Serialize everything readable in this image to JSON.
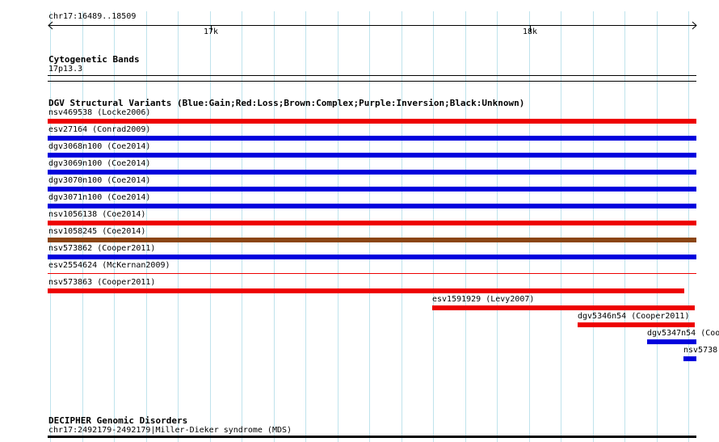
{
  "ruler": {
    "location": "chr17:16489..18509",
    "ticks": [
      "17k",
      "18k"
    ]
  },
  "cytoband": {
    "title": "Cytogenetic Bands",
    "band": "17p13.3"
  },
  "dgv": {
    "title": "DGV Structural Variants (Blue:Gain;Red:Loss;Brown:Complex;Purple:Inversion;Black:Unknown)",
    "colors": {
      "gain": "#0000dd",
      "loss": "#ee0000",
      "complex": "#8b4513",
      "inversion": "#800080",
      "unknown": "#000000"
    },
    "features": [
      {
        "label": "nsv469538 (Locke2006)",
        "type": "loss"
      },
      {
        "label": "esv27164 (Conrad2009)",
        "type": "gain"
      },
      {
        "label": "dgv3068n100 (Coe2014)",
        "type": "gain"
      },
      {
        "label": "dgv3069n100 (Coe2014)",
        "type": "gain"
      },
      {
        "label": "dgv3070n100 (Coe2014)",
        "type": "gain"
      },
      {
        "label": "dgv3071n100 (Coe2014)",
        "type": "gain"
      },
      {
        "label": "nsv1056138 (Coe2014)",
        "type": "loss"
      },
      {
        "label": "nsv1058245 (Coe2014)",
        "type": "complex"
      },
      {
        "label": "nsv573862 (Cooper2011)",
        "type": "gain"
      },
      {
        "label": "esv2554624 (McKernan2009)",
        "type": "loss"
      },
      {
        "label": "nsv573863 (Cooper2011)",
        "type": "loss"
      },
      {
        "label": "esv1591929 (Levy2007)",
        "type": "loss"
      },
      {
        "label": "dgv5346n54 (Cooper2011)",
        "type": "loss"
      },
      {
        "label": "dgv5347n54 (Coo",
        "type": "gain"
      },
      {
        "label": "nsv5738",
        "type": "gain"
      }
    ]
  },
  "decipher": {
    "title": "DECIPHER Genomic Disorders",
    "feature": "chr17:2492179-2492179|Miller-Dieker syndrome (MDS)"
  }
}
